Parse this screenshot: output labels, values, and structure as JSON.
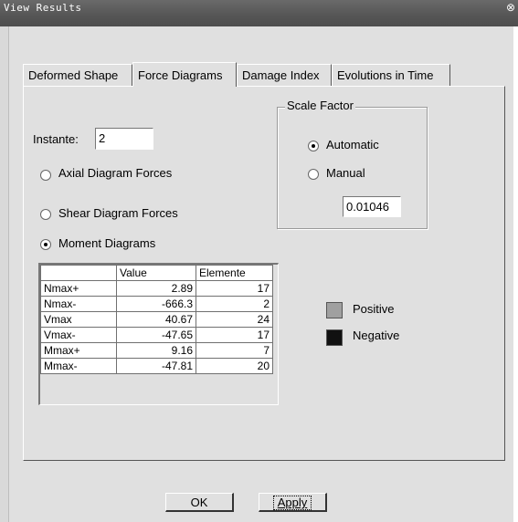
{
  "window": {
    "title": "View Results",
    "close_glyph": "⊗"
  },
  "tabs": [
    {
      "label": "Deformed Shape"
    },
    {
      "label": "Force Diagrams"
    },
    {
      "label": "Damage Index"
    },
    {
      "label": "Evolutions in Time"
    }
  ],
  "active_tab": "Force Diagrams",
  "instante": {
    "label": "Instante:",
    "value": "2"
  },
  "diagram_options": [
    {
      "label": "Axial Diagram Forces",
      "selected": false
    },
    {
      "label": "Shear Diagram Forces",
      "selected": false
    },
    {
      "label": "Moment Diagrams",
      "selected": true
    }
  ],
  "scale_factor": {
    "title": "Scale Factor",
    "automatic_label": "Automatic",
    "manual_label": "Manual",
    "selected": "Automatic",
    "value": "0.01046"
  },
  "results_table": {
    "headers": [
      "",
      "Value",
      "Elemente"
    ],
    "rows": [
      {
        "name": "Nmax+",
        "value": "2.89",
        "element": "17"
      },
      {
        "name": "Nmax-",
        "value": "-666.3",
        "element": "2"
      },
      {
        "name": "Vmax",
        "value": "40.67",
        "element": "24"
      },
      {
        "name": "Vmax-",
        "value": "-47.65",
        "element": "17"
      },
      {
        "name": "Mmax+",
        "value": "9.16",
        "element": "7"
      },
      {
        "name": "Mmax-",
        "value": "-47.81",
        "element": "20"
      }
    ]
  },
  "legend": [
    {
      "label": "Positive",
      "color": "#a0a0a0"
    },
    {
      "label": "Negative",
      "color": "#111111"
    }
  ],
  "buttons": {
    "ok": "OK",
    "apply": "Apply"
  }
}
